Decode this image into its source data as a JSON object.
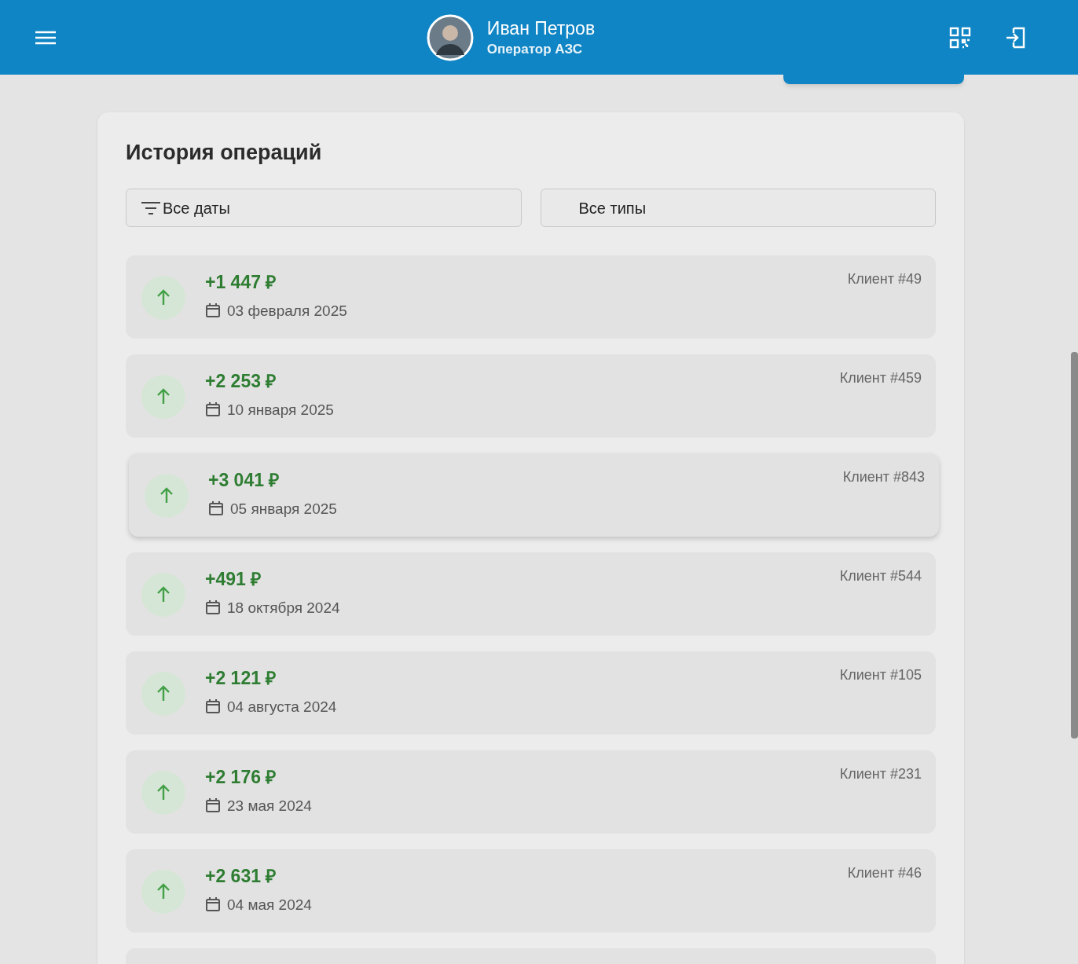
{
  "header": {
    "user_name": "Иван Петров",
    "user_role": "Оператор АЗС"
  },
  "history": {
    "title": "История операций",
    "filters": [
      {
        "kind": "date",
        "label": "Все даты"
      },
      {
        "kind": "type",
        "label": "Все типы"
      }
    ],
    "operations": [
      {
        "amount": "+1 447 ₽",
        "date": "03 февраля 2025",
        "client": "Клиент #49",
        "hovered": false
      },
      {
        "amount": "+2 253 ₽",
        "date": "10 января 2025",
        "client": "Клиент #459",
        "hovered": false
      },
      {
        "amount": "+3 041 ₽",
        "date": "05 января 2025",
        "client": "Клиент #843",
        "hovered": true
      },
      {
        "amount": "+491 ₽",
        "date": "18 октября 2024",
        "client": "Клиент #544",
        "hovered": false
      },
      {
        "amount": "+2 121 ₽",
        "date": "04 августа 2024",
        "client": "Клиент #105",
        "hovered": false
      },
      {
        "amount": "+2 176 ₽",
        "date": "23 мая 2024",
        "client": "Клиент #231",
        "hovered": false
      },
      {
        "amount": "+2 631 ₽",
        "date": "04 мая 2024",
        "client": "Клиент #46",
        "hovered": false
      }
    ]
  }
}
